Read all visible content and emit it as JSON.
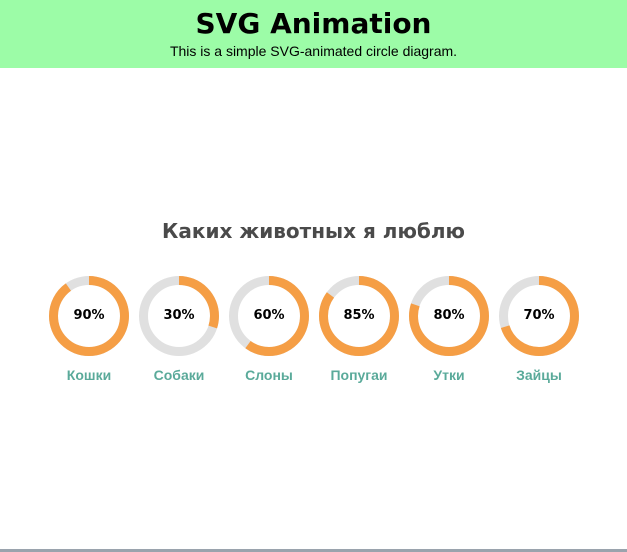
{
  "header": {
    "title": "SVG Animation",
    "subtitle": "This is a simple SVG-animated circle diagram."
  },
  "section": {
    "title": "Каких животных я люблю"
  },
  "colors": {
    "header_bg": "#9cfca7",
    "ring_fill": "#f59e45",
    "ring_track": "#e0e0e0",
    "label": "#5aaa9a",
    "title": "#4a4a4a"
  },
  "charts": [
    {
      "label": "Кошки",
      "percent": 90,
      "percent_text": "90%"
    },
    {
      "label": "Собаки",
      "percent": 30,
      "percent_text": "30%"
    },
    {
      "label": "Слоны",
      "percent": 60,
      "percent_text": "60%"
    },
    {
      "label": "Попугаи",
      "percent": 85,
      "percent_text": "85%"
    },
    {
      "label": "Утки",
      "percent": 80,
      "percent_text": "80%"
    },
    {
      "label": "Зайцы",
      "percent": 70,
      "percent_text": "70%"
    }
  ]
}
